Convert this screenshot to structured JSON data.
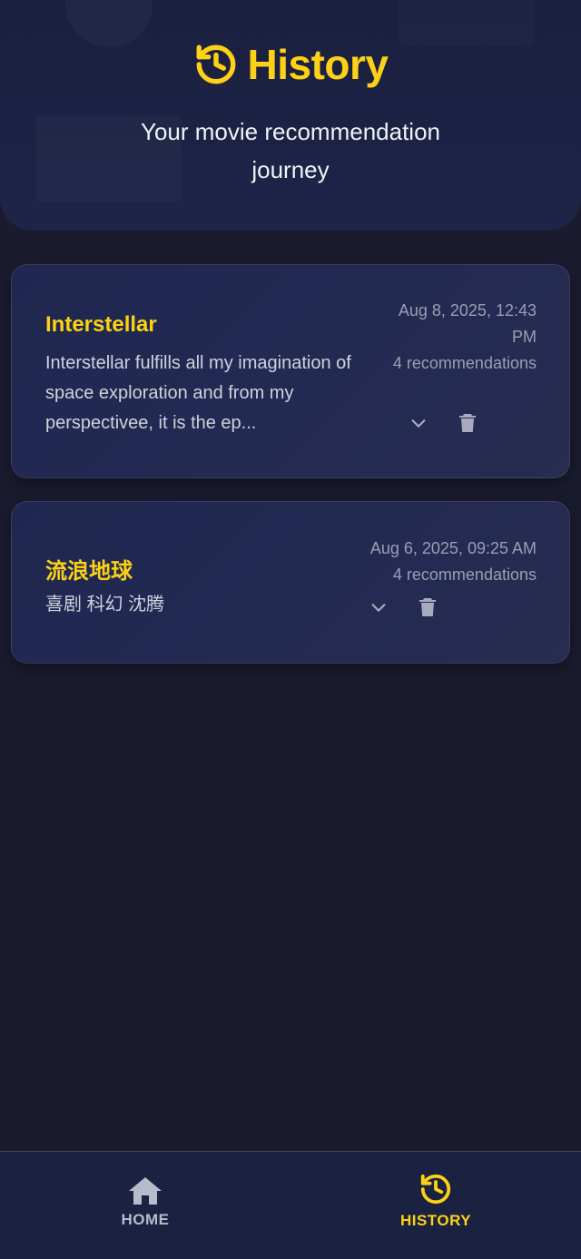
{
  "header": {
    "title": "History",
    "subtitle": "Your movie recommendation journey",
    "icon": "history-icon"
  },
  "history": [
    {
      "title": "Interstellar",
      "description": "Interstellar fulfills all my imagination of space exploration and from my perspectivee, it is the ep...",
      "date": "Aug 8, 2025, 12:43 PM",
      "count": "4 recommendations"
    },
    {
      "title": "流浪地球",
      "description": "喜剧 科幻 沈腾",
      "date": "Aug 6, 2025, 09:25 AM",
      "count": "4 recommendations"
    }
  ],
  "nav": {
    "home": {
      "label": "HOME",
      "icon": "home-icon"
    },
    "history": {
      "label": "HISTORY",
      "icon": "history-icon",
      "active": true
    }
  },
  "colors": {
    "accent": "#fcd116",
    "background": "#1a1b2e",
    "card": "#222a52",
    "muted": "#9a9fb3"
  }
}
